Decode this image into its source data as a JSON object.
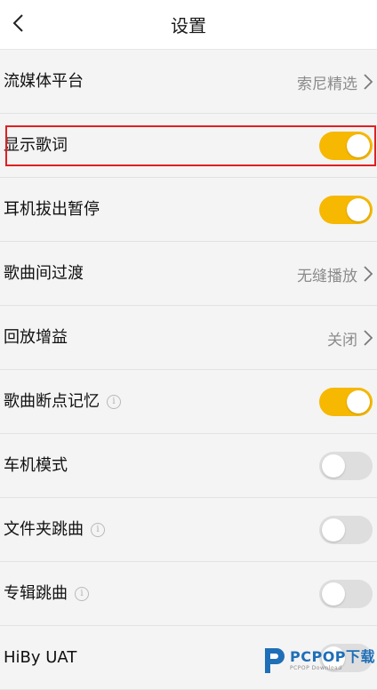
{
  "header": {
    "title": "设置"
  },
  "rows": [
    {
      "label": "流媒体平台",
      "value": "索尼精选"
    },
    {
      "label": "显示歌词",
      "toggle_on": true
    },
    {
      "label": "耳机拔出暂停",
      "toggle_on": true
    },
    {
      "label": "歌曲间过渡",
      "value": "无缝播放"
    },
    {
      "label": "回放增益",
      "value": "关闭"
    },
    {
      "label": "歌曲断点记忆",
      "info": "i",
      "toggle_on": true
    },
    {
      "label": "车机模式",
      "toggle_on": false
    },
    {
      "label": "文件夹跳曲",
      "info": "i",
      "toggle_on": false
    },
    {
      "label": "专辑跳曲",
      "info": "i",
      "toggle_on": false
    },
    {
      "label": "HiBy UAT",
      "toggle_on": false
    }
  ],
  "watermark": {
    "logo_text": "PCPOP下载",
    "sub_text": "PCPOP Download"
  },
  "colors": {
    "toggle_on": "#f6b800",
    "toggle_off": "#dedede",
    "highlight": "#e02020",
    "value_text": "#8b8b8b"
  }
}
